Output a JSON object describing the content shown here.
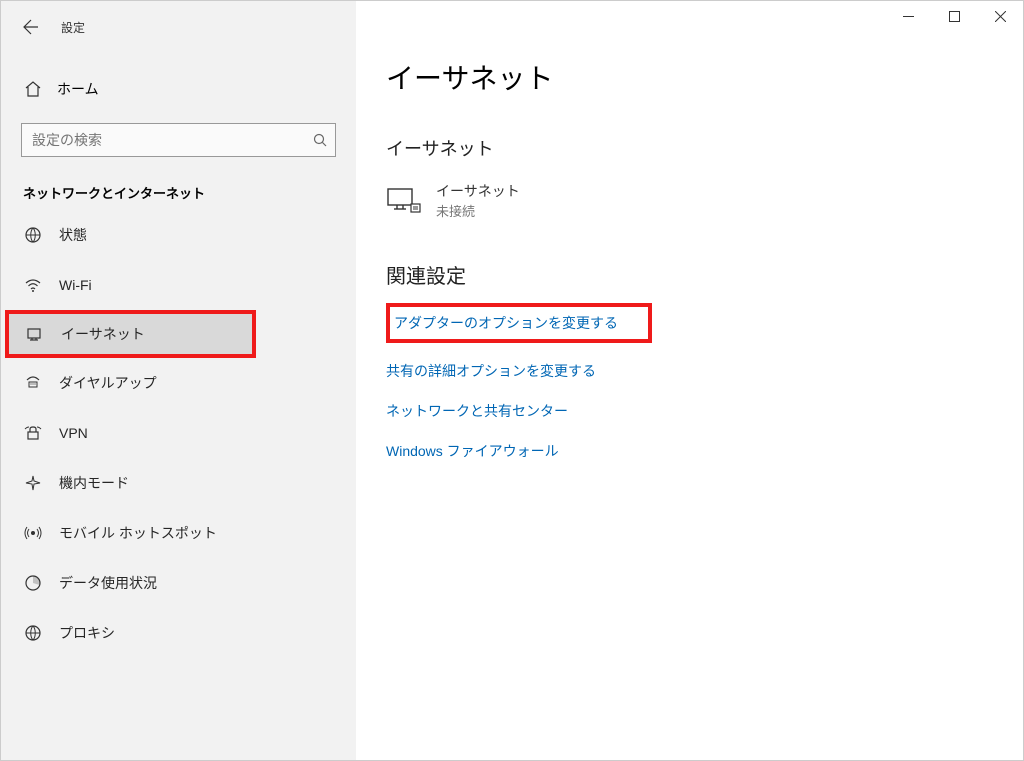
{
  "header": {
    "window_title": "設定"
  },
  "sidebar": {
    "home_label": "ホーム",
    "search_placeholder": "設定の検索",
    "section_title": "ネットワークとインターネット",
    "items": [
      {
        "icon": "status-icon",
        "label": "状態"
      },
      {
        "icon": "wifi-icon",
        "label": "Wi-Fi"
      },
      {
        "icon": "ethernet-icon",
        "label": "イーサネット"
      },
      {
        "icon": "dialup-icon",
        "label": "ダイヤルアップ"
      },
      {
        "icon": "vpn-icon",
        "label": "VPN"
      },
      {
        "icon": "airplane-icon",
        "label": "機内モード"
      },
      {
        "icon": "hotspot-icon",
        "label": "モバイル ホットスポット"
      },
      {
        "icon": "data-usage-icon",
        "label": "データ使用状況"
      },
      {
        "icon": "proxy-icon",
        "label": "プロキシ"
      }
    ]
  },
  "main": {
    "page_title": "イーサネット",
    "subheading": "イーサネット",
    "ethernet_status": {
      "name": "イーサネット",
      "status": "未接続"
    },
    "related_title": "関連設定",
    "links": [
      "アダプターのオプションを変更する",
      "共有の詳細オプションを変更する",
      "ネットワークと共有センター",
      "Windows ファイアウォール"
    ]
  }
}
